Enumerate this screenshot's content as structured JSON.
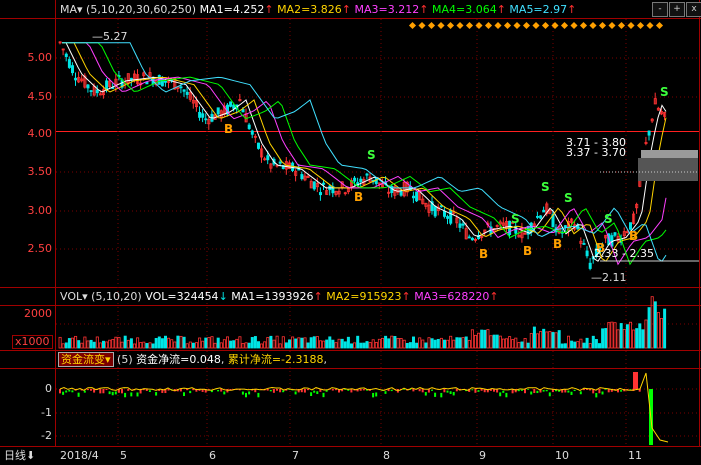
{
  "colors": {
    "up": "#ff3333",
    "down": "#00e5e5",
    "ma1": "#ffffff",
    "ma2": "#ffd400",
    "ma3": "#ff40ff",
    "ma4": "#00ff00",
    "ma5": "#40e0ff",
    "buy": "#ffa000",
    "sell": "#3cff3c"
  },
  "price_panel": {
    "indicator_name": "MA",
    "params": "(5,10,20,30,60,250)",
    "ma1": "MA1=4.252",
    "ma2": "MA2=3.826",
    "ma3": "MA3=3.212",
    "ma4": "MA4=3.064",
    "ma5": "MA5=2.97",
    "axis_ticks": [
      "5.00",
      "4.50",
      "4.00",
      "3.50",
      "3.00",
      "2.50"
    ],
    "high_label": "5.27",
    "low_label": "2.11",
    "range_up_1": "3.71 - 3.80",
    "range_up_2": "3.37 - 3.70",
    "range_low": "2.33 - 2.35",
    "buy_mark": "B",
    "sell_mark": "S"
  },
  "volume_panel": {
    "indicator_name": "VOL",
    "params": "(5,10,20)",
    "vol": "VOL=324454",
    "ma1": "MA1=1393926",
    "ma2": "MA2=915923",
    "ma3": "MA3=628220",
    "axis_tick": "2000",
    "unit": "x1000"
  },
  "flow_panel": {
    "indicator_name": "资金流变",
    "params": "(5)",
    "net": "资金净流=0.048",
    "cumulative": "累计净流=-2.3188",
    "axis_ticks": [
      "0",
      "-1",
      "-2"
    ]
  },
  "time_axis": {
    "period": "日线",
    "labels": [
      "2018/4",
      "5",
      "6",
      "7",
      "8",
      "9",
      "10",
      "11"
    ]
  },
  "toolbar": {
    "btn_minus": "-",
    "btn_plus": "+",
    "btn_close": "x"
  }
}
